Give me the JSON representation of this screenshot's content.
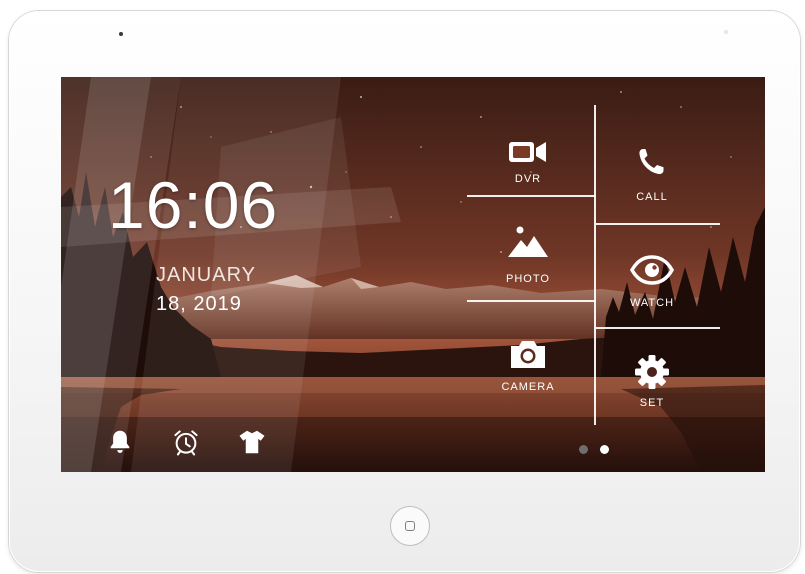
{
  "clock": {
    "time": "16:06",
    "month": "JANUARY",
    "day_year": "18, 2019"
  },
  "tiles": {
    "dvr": {
      "label": "DVR",
      "icon": "video-camera-icon"
    },
    "call": {
      "label": "CALL",
      "icon": "phone-icon"
    },
    "photo": {
      "label": "PHOTO",
      "icon": "image-mountains-icon"
    },
    "watch": {
      "label": "WATCH",
      "icon": "eye-icon"
    },
    "camera": {
      "label": "CAMERA",
      "icon": "camera-icon"
    },
    "set": {
      "label": "SET",
      "icon": "gear-icon"
    }
  },
  "bottom_icons": [
    "bell-icon",
    "alarm-clock-icon",
    "tshirt-icon"
  ],
  "pager": {
    "pages": 2,
    "current_page": 2
  },
  "colors": {
    "sky_top": "#3a1c14",
    "sky_glow": "#a2553b",
    "water": "#7a3f2c",
    "text": "#ffffff",
    "pager_inactive": "#6e6e6e",
    "pager_active": "#ffffff"
  }
}
